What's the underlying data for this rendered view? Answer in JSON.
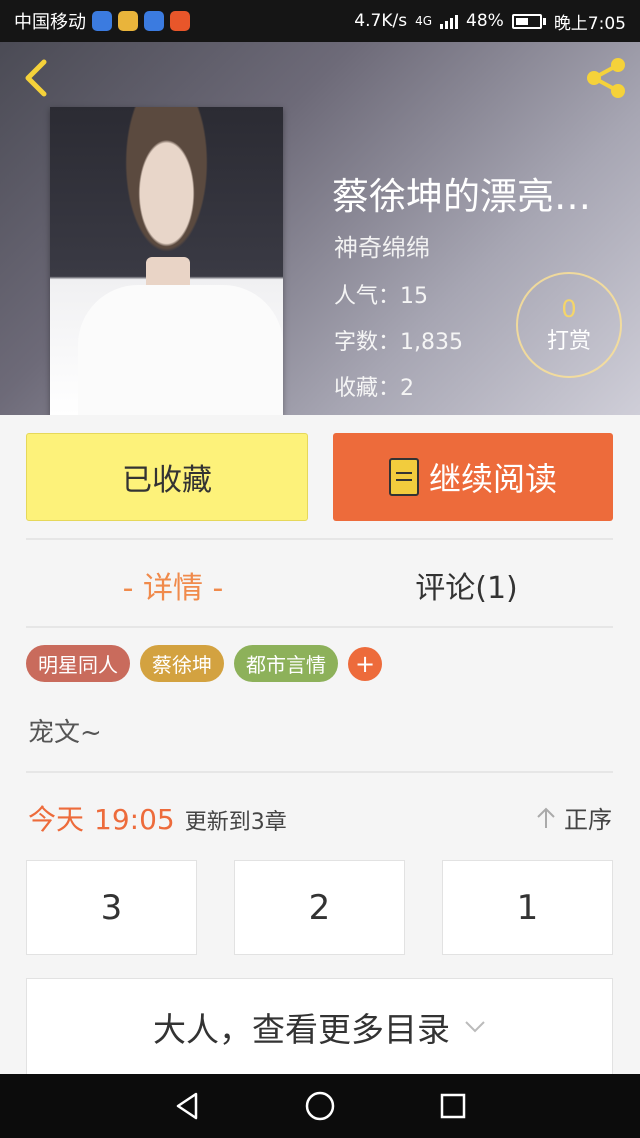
{
  "status_bar": {
    "carrier": "中国移动",
    "speed": "4.7K/s",
    "network": "4G",
    "battery": "48%",
    "time": "晚上7:05"
  },
  "book": {
    "title": "蔡徐坤的漂亮…",
    "author": "神奇绵绵",
    "popularity_label": "人气：",
    "popularity": "15",
    "words_label": "字数：",
    "words": "1,835",
    "favorites_label": "收藏：",
    "favorites": "2"
  },
  "tip": {
    "count": "0",
    "label": "打赏"
  },
  "actions": {
    "collected": "已收藏",
    "continue_reading": "继续阅读"
  },
  "tabs": {
    "details": "- 详情 -",
    "comments": "评论(1)"
  },
  "tags": [
    {
      "label": "明星同人",
      "color": "#c96b5c"
    },
    {
      "label": "蔡徐坤",
      "color": "#d3a240"
    },
    {
      "label": "都市言情",
      "color": "#8db15a"
    }
  ],
  "tag_add": "+",
  "summary": "宠文~",
  "update": {
    "day": "今天",
    "time": "19:05",
    "text": "更新到3章"
  },
  "sort": {
    "label": "正序"
  },
  "chapters": [
    "3",
    "2",
    "1"
  ],
  "more_toc": "大人，查看更多目录",
  "colors": {
    "accent": "#ed6b3b",
    "collected_bg": "#fdf27a",
    "tip_gold": "#f4d56a"
  }
}
